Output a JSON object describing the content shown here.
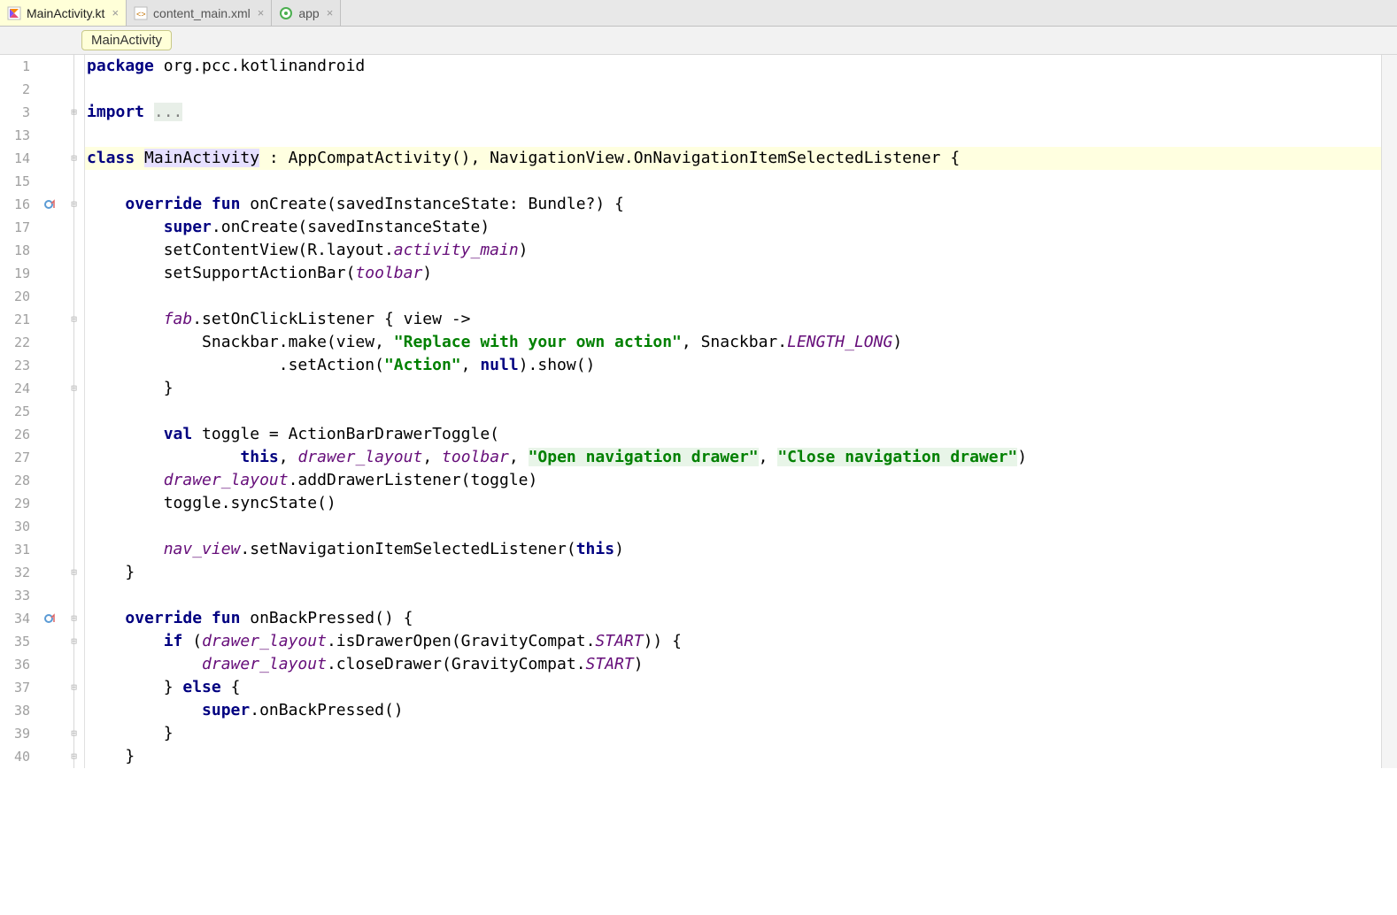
{
  "tabs": [
    {
      "label": "MainActivity.kt",
      "active": true
    },
    {
      "label": "content_main.xml",
      "active": false
    },
    {
      "label": "app",
      "active": false
    }
  ],
  "breadcrumb": "MainActivity",
  "gutter_lines": [
    "1",
    "2",
    "3",
    "13",
    "14",
    "15",
    "16",
    "17",
    "18",
    "19",
    "20",
    "21",
    "22",
    "23",
    "24",
    "25",
    "26",
    "27",
    "28",
    "29",
    "30",
    "31",
    "32",
    "33",
    "34",
    "35",
    "36",
    "37",
    "38",
    "39",
    "40"
  ],
  "code": {
    "l1_kw": "package",
    "l1_rest": " org.pcc.kotlinandroid",
    "l3_kw": "import ",
    "l3_dots": "...",
    "l14_kw1": "class ",
    "l14_name": "MainActivity",
    "l14_rest": " : AppCompatActivity(), NavigationView.OnNavigationItemSelectedListener {",
    "l16_pad": "    ",
    "l16_kw": "override fun",
    "l16_rest": " onCreate(savedInstanceState: Bundle?) {",
    "l17": "        ",
    "l17_kw": "super",
    "l17_rest": ".onCreate(savedInstanceState)",
    "l18": "        setContentView(R.layout.",
    "l18_field": "activity_main",
    "l18_rest": ")",
    "l19": "        setSupportActionBar(",
    "l19_field": "toolbar",
    "l19_rest": ")",
    "l21": "        ",
    "l21_field": "fab",
    "l21_rest": ".setOnClickListener { view ->",
    "l22": "            Snackbar.make(view, ",
    "l22_str": "\"Replace with your own action\"",
    "l22_mid": ", Snackbar.",
    "l22_const": "LENGTH_LONG",
    "l22_end": ")",
    "l23": "                    .setAction(",
    "l23_str": "\"Action\"",
    "l23_mid": ", ",
    "l23_kw": "null",
    "l23_end": ").show()",
    "l24": "        }",
    "l26": "        ",
    "l26_kw": "val",
    "l26_rest": " toggle = ActionBarDrawerToggle(",
    "l27": "                ",
    "l27_kw": "this",
    "l27_a": ", ",
    "l27_f1": "drawer_layout",
    "l27_b": ", ",
    "l27_f2": "toolbar",
    "l27_c": ", ",
    "l27_s1": "\"Open navigation drawer\"",
    "l27_d": ", ",
    "l27_s2": "\"Close navigation drawer\"",
    "l27_e": ")",
    "l28": "        ",
    "l28_field": "drawer_layout",
    "l28_rest": ".addDrawerListener(toggle)",
    "l29": "        toggle.syncState()",
    "l31": "        ",
    "l31_field": "nav_view",
    "l31_mid": ".setNavigationItemSelectedListener(",
    "l31_kw": "this",
    "l31_end": ")",
    "l32": "    }",
    "l34": "    ",
    "l34_kw": "override fun",
    "l34_rest": " onBackPressed() {",
    "l35": "        ",
    "l35_kw": "if",
    "l35_a": " (",
    "l35_field": "drawer_layout",
    "l35_b": ".isDrawerOpen(GravityCompat.",
    "l35_const": "START",
    "l35_c": ")) {",
    "l36": "            ",
    "l36_field": "drawer_layout",
    "l36_mid": ".closeDrawer(GravityCompat.",
    "l36_const": "START",
    "l36_end": ")",
    "l37": "        } ",
    "l37_kw": "else",
    "l37_rest": " {",
    "l38": "            ",
    "l38_kw": "super",
    "l38_rest": ".onBackPressed()",
    "l39": "        }",
    "l40": "    }"
  }
}
